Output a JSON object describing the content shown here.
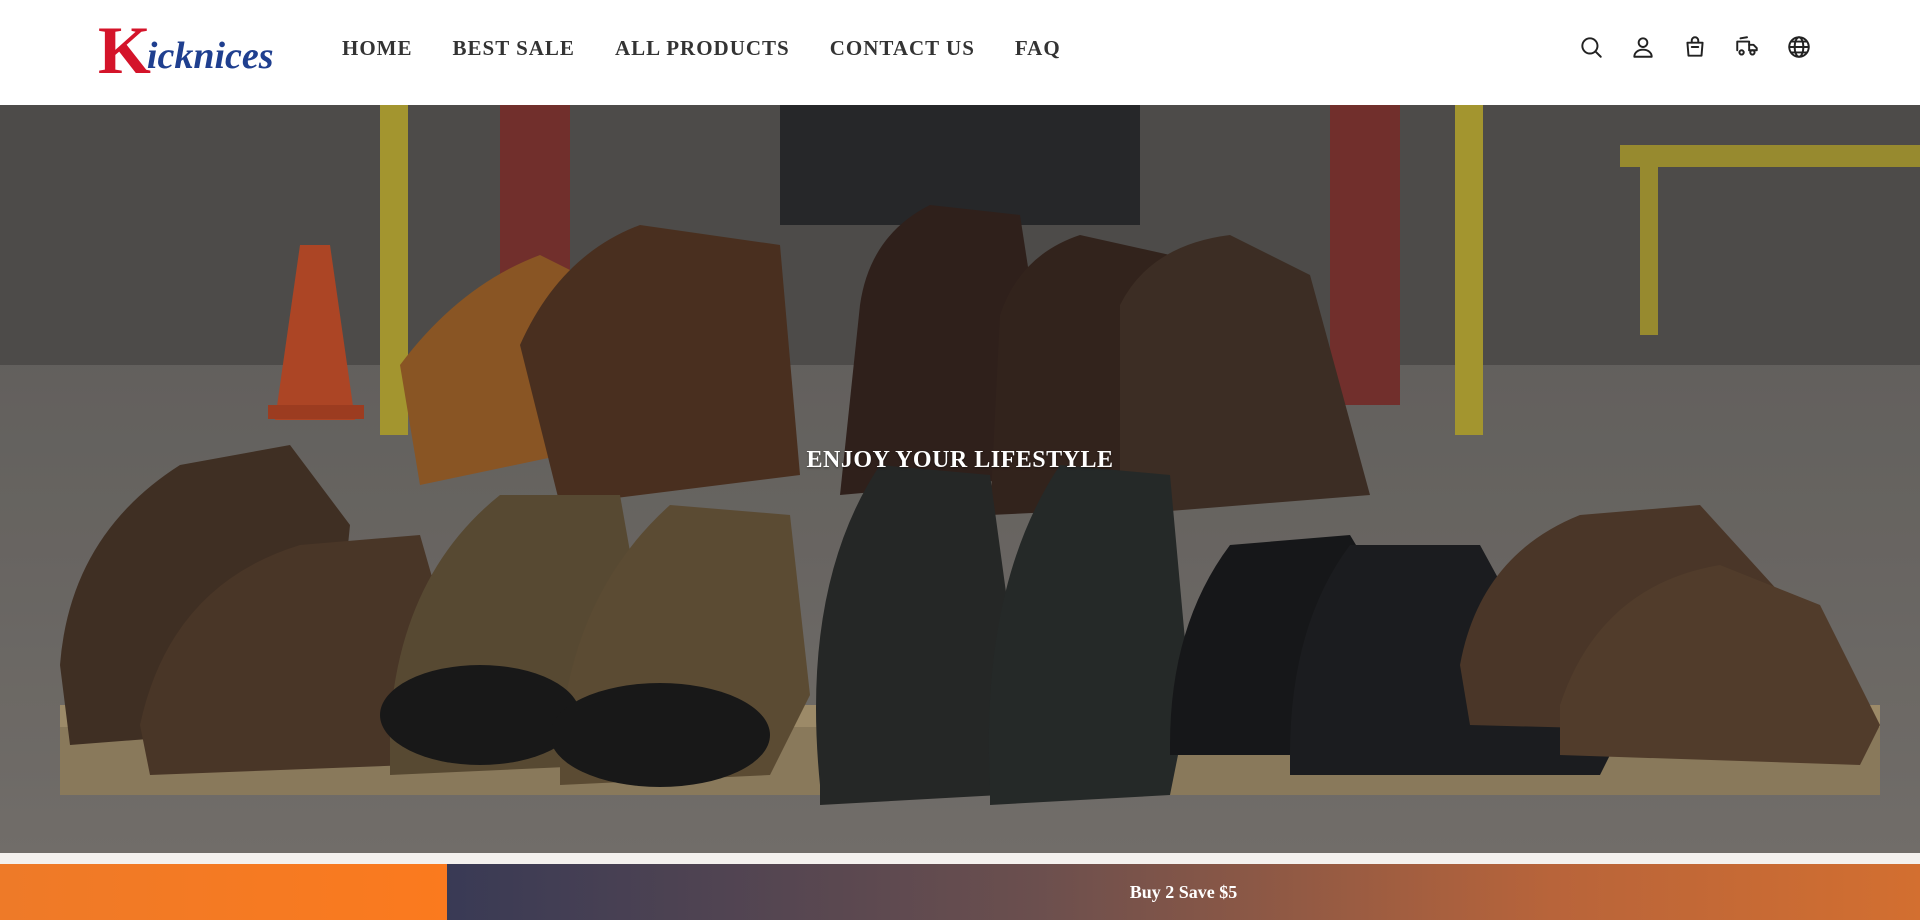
{
  "brand": {
    "logo_initial": "K",
    "logo_rest": "icknices"
  },
  "nav": {
    "items": [
      {
        "label": "HOME"
      },
      {
        "label": "BEST SALE"
      },
      {
        "label": "ALL PRODUCTS"
      },
      {
        "label": "CONTACT US"
      },
      {
        "label": "FAQ"
      }
    ]
  },
  "header_icons": [
    "search-icon",
    "account-icon",
    "cart-icon",
    "shipping-icon",
    "globe-icon"
  ],
  "hero": {
    "title": "ENJOY YOUR LIFESTYLE"
  },
  "promo": {
    "text": "Buy 2 Save $5"
  },
  "colors": {
    "logo_red": "#d4142a",
    "logo_blue": "#1f3f8f",
    "promo_orange": "#f47a22",
    "promo_dark": "#393a55"
  }
}
